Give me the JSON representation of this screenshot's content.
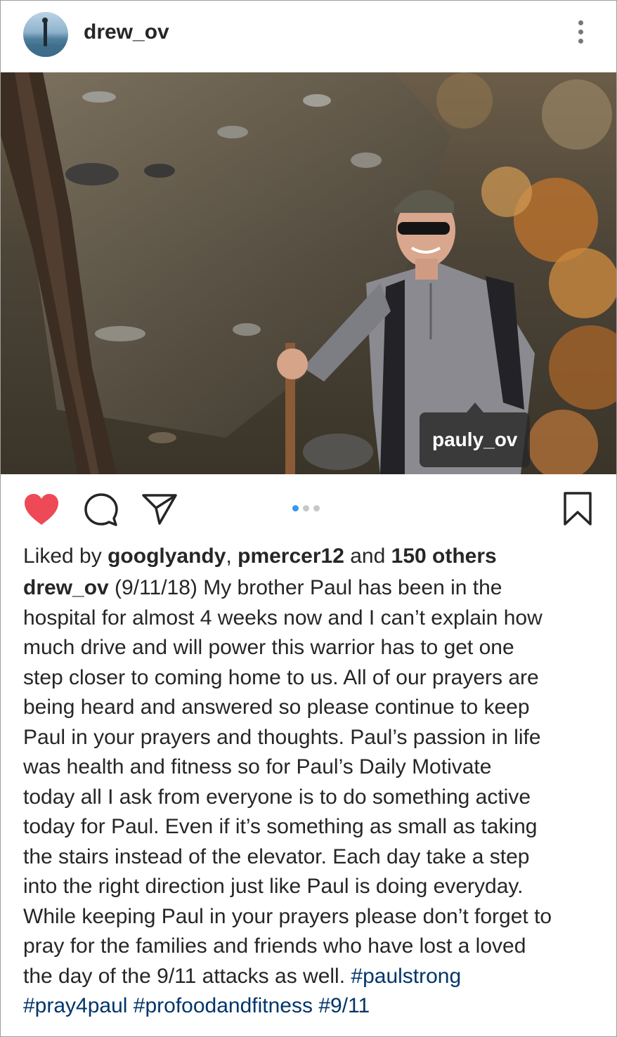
{
  "post": {
    "username": "drew_ov",
    "photo_tag": "pauly_ov",
    "likes": {
      "prefix": "Liked by",
      "user1": "googlyandy",
      "separator": ",",
      "user2": "pmercer12",
      "and": "and",
      "others": "150 others"
    },
    "caption": {
      "author": "drew_ov",
      "text": " (9/11/18) My brother Paul has been in the\nhospital for almost 4 weeks now and I can’t explain how\nmuch drive and will power this warrior has to get one\nstep closer to coming home to us. All of our prayers are\nbeing heard and answered so please continue to keep\nPaul in your prayers and thoughts. Paul’s passion in life\nwas health and fitness so for Paul’s Daily Motivate\ntoday all I ask from everyone is to do something active\ntoday for Paul. Even if it’s something as small as taking\nthe stairs instead of the elevator. Each day take a step\ninto the right direction just like Paul is doing everyday.\nWhile keeping Paul in your prayers please don’t forget to\npray for the families and friends who have lost a loved\nthe day of the 9/11 attacks as well. ",
      "hashtags": [
        "#paulstrong",
        "#pray4paul",
        "#profoodandfitness",
        "#9/11"
      ]
    },
    "carousel": {
      "count": 3,
      "active_index": 0
    },
    "liked": true
  },
  "icons": {
    "more": "more-options-icon",
    "like": "heart-icon",
    "comment": "comment-icon",
    "share": "share-icon",
    "save": "bookmark-icon",
    "tags": "user-tag-icon"
  },
  "colors": {
    "heart": "#ed4956",
    "link": "#003569",
    "carousel_active": "#3897f0",
    "carousel_inactive": "#c7c7c7"
  }
}
